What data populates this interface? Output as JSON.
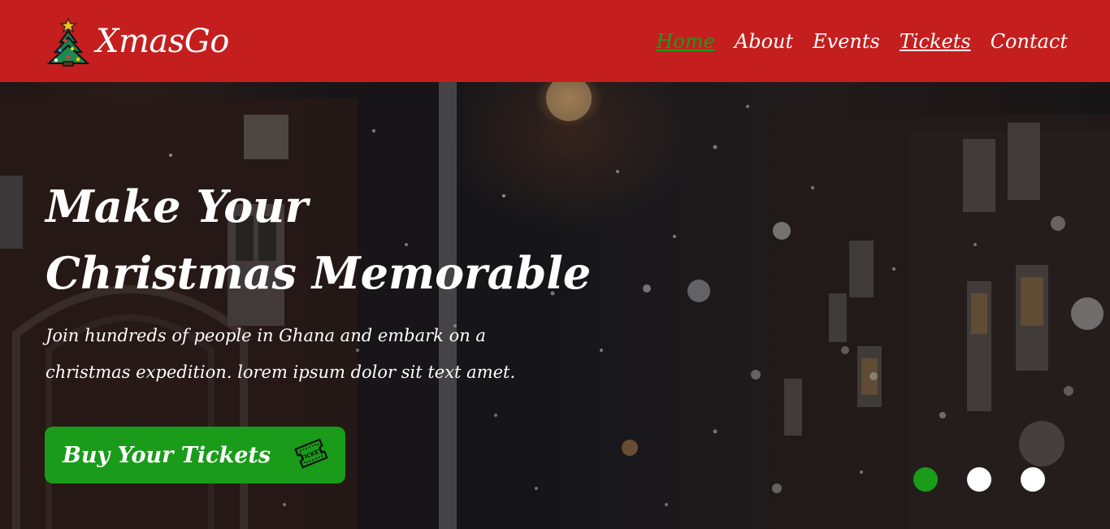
{
  "brand": {
    "name": "XmasGo",
    "logo_icon": "christmas-tree-icon"
  },
  "nav": {
    "items": [
      {
        "label": "Home",
        "state": "active"
      },
      {
        "label": "About",
        "state": "normal"
      },
      {
        "label": "Events",
        "state": "normal"
      },
      {
        "label": "Tickets",
        "state": "underlined"
      },
      {
        "label": "Contact",
        "state": "normal"
      }
    ]
  },
  "hero": {
    "title_line1": "Make Your",
    "title_line2": "Christmas Memorable",
    "subtitle": "Join hundreds of people in Ghana and embark on a christmas expedition. lorem ipsum dolor sit text amet.",
    "cta_label": "Buy Your Tickets",
    "cta_icon": "ticket-icon",
    "cta_icon_text": "TICKET"
  },
  "slider": {
    "count": 3,
    "active_index": 0
  },
  "colors": {
    "navbar_bg": "#c41e1e",
    "accent_green": "#1a9b1a",
    "text": "#ffffff"
  }
}
